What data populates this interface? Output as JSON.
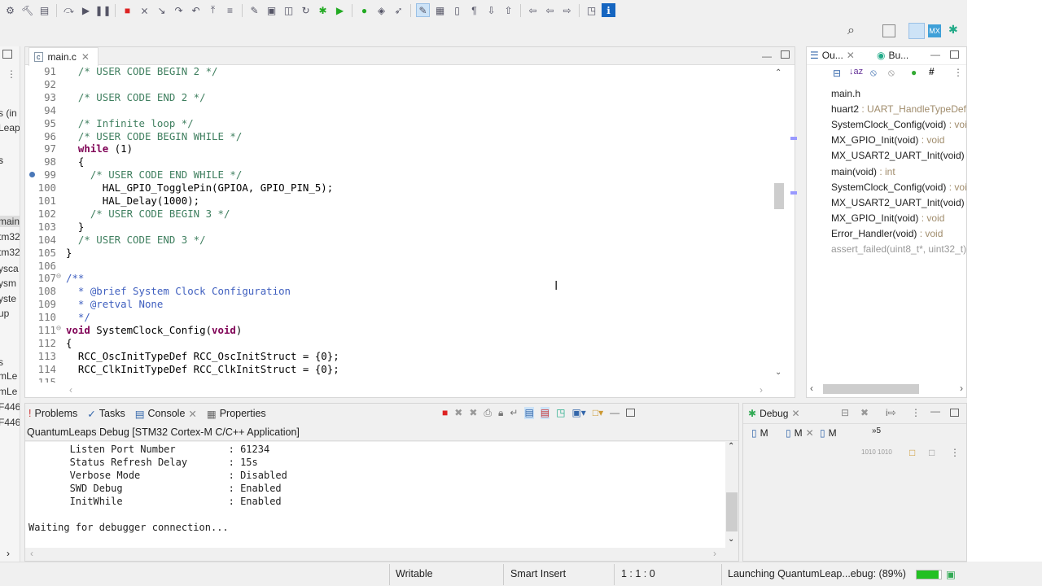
{
  "toolbar": {
    "icons": [
      "settings-icon",
      "build-icon",
      "save-icon",
      "skip-icon",
      "resume-icon",
      "suspend-icon",
      "terminate-icon",
      "disconnect-icon",
      "step-into-icon",
      "step-over-icon",
      "step-return-icon",
      "drop-frame-icon",
      "instruction-step-icon",
      "new-icon",
      "open-icon",
      "new-class-icon",
      "refresh-icon",
      "debug-icon",
      "run-icon",
      "external-tools-icon",
      "open-type-icon",
      "search-icon",
      "toggle-mark-icon",
      "annotation-icon",
      "block-select-icon",
      "whitespace-icon",
      "next-annotation-icon",
      "prev-annotation-icon",
      "last-edit-icon",
      "back-icon",
      "forward-icon",
      "perspective-icon",
      "info-icon"
    ],
    "search_icon": "search-icon"
  },
  "left_strip": {
    "items": [
      "s (in",
      "Leap",
      "s",
      "s",
      "main",
      "tm32",
      "tm32",
      "ysca",
      "ysm",
      "yste",
      "up",
      "s",
      "mLe",
      "mLe",
      "F446",
      "F446"
    ]
  },
  "editor": {
    "tab": "main.c",
    "lines": [
      {
        "n": "91",
        "s": [
          {
            "c": "cm",
            "t": "  /* USER CODE BEGIN 2 */"
          }
        ]
      },
      {
        "n": "92",
        "s": []
      },
      {
        "n": "93",
        "s": [
          {
            "c": "cm",
            "t": "  /* USER CODE END 2 */"
          }
        ]
      },
      {
        "n": "94",
        "s": []
      },
      {
        "n": "95",
        "s": [
          {
            "c": "cm",
            "t": "  /* Infinite loop */"
          }
        ]
      },
      {
        "n": "96",
        "s": [
          {
            "c": "cm",
            "t": "  /* USER CODE BEGIN WHILE */"
          }
        ]
      },
      {
        "n": "97",
        "s": [
          {
            "c": "kw",
            "t": "  while"
          },
          {
            "c": "tx",
            "t": " (1)"
          }
        ]
      },
      {
        "n": "98",
        "s": [
          {
            "c": "tx",
            "t": "  {"
          }
        ]
      },
      {
        "n": "99",
        "s": [
          {
            "c": "cm",
            "t": "    /* USER CODE END WHILE */"
          }
        ],
        "marker": true
      },
      {
        "n": "100",
        "s": [
          {
            "c": "tx",
            "t": "      HAL_GPIO_TogglePin(GPIOA, GPIO_PIN_5);"
          }
        ]
      },
      {
        "n": "101",
        "s": [
          {
            "c": "tx",
            "t": "      HAL_Delay(1000);"
          }
        ]
      },
      {
        "n": "102",
        "s": [
          {
            "c": "cm",
            "t": "    /* USER CODE BEGIN 3 */"
          }
        ]
      },
      {
        "n": "103",
        "s": [
          {
            "c": "tx",
            "t": "  }"
          }
        ]
      },
      {
        "n": "104",
        "s": [
          {
            "c": "cm",
            "t": "  /* USER CODE END 3 */"
          }
        ]
      },
      {
        "n": "105",
        "s": [
          {
            "c": "tx",
            "t": "}"
          }
        ]
      },
      {
        "n": "106",
        "s": []
      },
      {
        "n": "107",
        "s": [
          {
            "c": "dc",
            "t": "/**"
          }
        ],
        "fold": true
      },
      {
        "n": "108",
        "s": [
          {
            "c": "dc",
            "t": "  * @brief System Clock Configuration"
          }
        ]
      },
      {
        "n": "109",
        "s": [
          {
            "c": "dc",
            "t": "  * @retval None"
          }
        ]
      },
      {
        "n": "110",
        "s": [
          {
            "c": "dc",
            "t": "  */"
          }
        ]
      },
      {
        "n": "111",
        "s": [
          {
            "c": "kw",
            "t": "void"
          },
          {
            "c": "tx",
            "t": " SystemClock_Config("
          },
          {
            "c": "kw",
            "t": "void"
          },
          {
            "c": "tx",
            "t": ")"
          }
        ],
        "fold": true
      },
      {
        "n": "112",
        "s": [
          {
            "c": "tx",
            "t": "{"
          }
        ]
      },
      {
        "n": "113",
        "s": [
          {
            "c": "tx",
            "t": "  RCC_OscInitTypeDef RCC_OscInitStruct = {0};"
          }
        ]
      },
      {
        "n": "114",
        "s": [
          {
            "c": "tx",
            "t": "  RCC_ClkInitTypeDef RCC_ClkInitStruct = {0};"
          }
        ]
      },
      {
        "n": "115",
        "s": []
      }
    ]
  },
  "outline": {
    "tab1": "Ou...",
    "tab2": "Bu...",
    "items": [
      {
        "icon": "header-file-icon",
        "name": "main.h",
        "type": ""
      },
      {
        "icon": "variable-icon",
        "name": "huart2",
        "type": " : UART_HandleTypeDef"
      },
      {
        "icon": "function-declaration-icon",
        "name": "SystemClock_Config(void)",
        "type": " : void"
      },
      {
        "icon": "static-function-declaration-icon",
        "name": "MX_GPIO_Init(void)",
        "type": " : void",
        "static": "S"
      },
      {
        "icon": "static-function-declaration-icon",
        "name": "MX_USART2_UART_Init(void)",
        "type": " : void",
        "static": "S"
      },
      {
        "icon": "function-icon",
        "name": "main(void)",
        "type": " : int"
      },
      {
        "icon": "function-icon",
        "name": "SystemClock_Config(void)",
        "type": " : void"
      },
      {
        "icon": "static-function-icon",
        "name": "MX_USART2_UART_Init(void)",
        "type": " : void",
        "static": "S"
      },
      {
        "icon": "static-function-icon",
        "name": "MX_GPIO_Init(void)",
        "type": " : void",
        "static": "S"
      },
      {
        "icon": "function-icon",
        "name": "Error_Handler(void)",
        "type": " : void"
      },
      {
        "icon": "inactive-function-icon",
        "name": "assert_failed(uint8_t*, uint32_t)",
        "type": " : void",
        "inactive": true
      }
    ]
  },
  "console": {
    "tabs": [
      "Problems",
      "Tasks",
      "Console",
      "Properties"
    ],
    "header": "QuantumLeaps Debug [STM32 Cortex-M C/C++ Application]",
    "lines": [
      "       Listen Port Number         : 61234",
      "       Status Refresh Delay       : 15s",
      "       Verbose Mode               : Disabled",
      "       SWD Debug                  : Enabled",
      "       InitWhile                  : Enabled",
      "",
      "Waiting for debugger connection..."
    ]
  },
  "debug": {
    "tab": "Debug",
    "subtabs": [
      "M",
      "M",
      "M"
    ],
    "more": "»5"
  },
  "status": {
    "writable": "Writable",
    "insert": "Smart Insert",
    "position": "1 : 1 : 0",
    "progress_text": "Launching QuantumLeap...ebug: (89%)",
    "progress": 0.89
  },
  "colors": {
    "comment": "#3f7f5f",
    "keyword": "#7f0055",
    "progress": "#22c022"
  }
}
